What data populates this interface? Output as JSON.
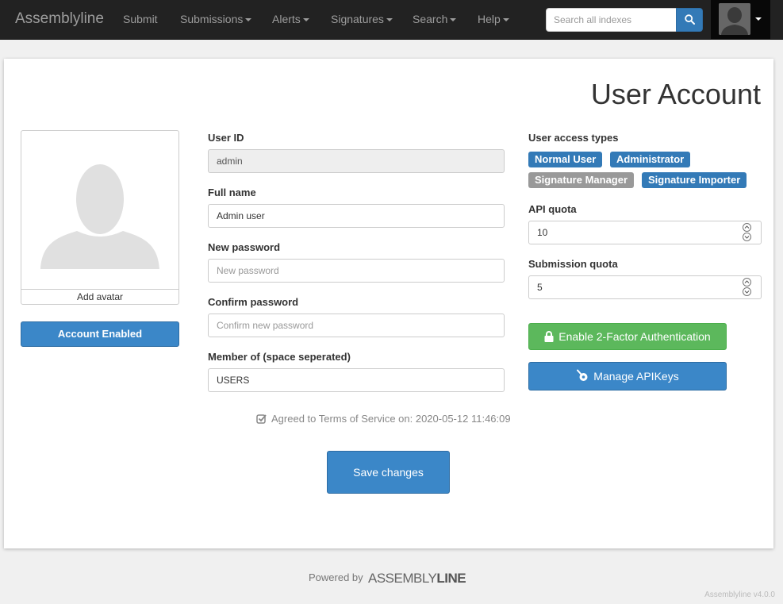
{
  "nav": {
    "brand": "Assemblyline",
    "items": [
      {
        "label": "Submit",
        "dropdown": false
      },
      {
        "label": "Submissions",
        "dropdown": true
      },
      {
        "label": "Alerts",
        "dropdown": true
      },
      {
        "label": "Signatures",
        "dropdown": true
      },
      {
        "label": "Search",
        "dropdown": true
      },
      {
        "label": "Help",
        "dropdown": true
      }
    ],
    "search_placeholder": "Search all indexes",
    "search_icon": "search-icon",
    "user_icon": "user-avatar-icon"
  },
  "page": {
    "title": "User Account"
  },
  "avatar": {
    "add_label": "Add avatar",
    "icon": "user-silhouette-icon"
  },
  "account_status": {
    "label": "Account Enabled"
  },
  "form": {
    "user_id": {
      "label": "User ID",
      "value": "admin"
    },
    "full_name": {
      "label": "Full name",
      "value": "Admin user"
    },
    "new_password": {
      "label": "New password",
      "placeholder": "New password",
      "value": ""
    },
    "confirm_password": {
      "label": "Confirm password",
      "placeholder": "Confirm new password",
      "value": ""
    },
    "groups": {
      "label": "Member of (space seperated)",
      "value": "USERS"
    }
  },
  "tos": {
    "text": "Agreed to Terms of Service on: 2020-05-12 11:46:09",
    "icon": "check-square-icon"
  },
  "save": {
    "label": "Save changes"
  },
  "access": {
    "label": "User access types",
    "types": [
      {
        "label": "Normal User",
        "active": true
      },
      {
        "label": "Administrator",
        "active": true
      },
      {
        "label": "Signature Manager",
        "active": false
      },
      {
        "label": "Signature Importer",
        "active": true
      }
    ]
  },
  "api_quota": {
    "label": "API quota",
    "value": "10"
  },
  "submission_quota": {
    "label": "Submission quota",
    "value": "5"
  },
  "two_factor": {
    "label": "Enable 2-Factor Authentication",
    "icon": "lock-icon"
  },
  "apikeys": {
    "label": "Manage APIKeys",
    "icon": "key-icon"
  },
  "footer": {
    "powered_by": "Powered by",
    "logo_assembly": "ASSEMBLY",
    "logo_line": "LINE",
    "version": "Assemblyline v4.0.0"
  },
  "colors": {
    "primary": "#337ab7",
    "success": "#5cb85c",
    "navbar": "#222222",
    "badge_inactive": "#999999"
  }
}
